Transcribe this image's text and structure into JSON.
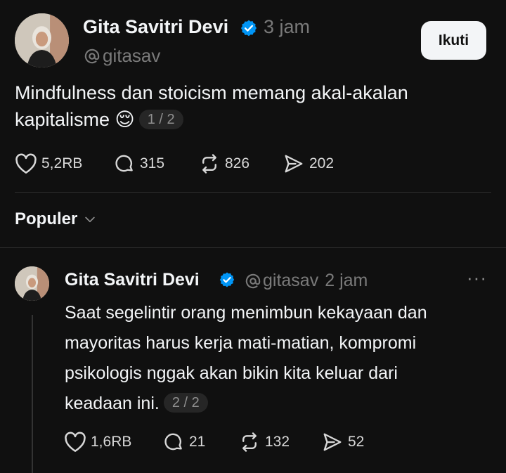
{
  "post": {
    "author": "Gita Savitri Devi",
    "handle": "gitasav",
    "time": "3 jam",
    "follow_label": "Ikuti",
    "text_line1": "Mindfulness dan stoicism memang akal-akalan",
    "text_line2": "kapitalisme 😌",
    "counter": "1 / 2",
    "likes": "5,2RB",
    "replies": "315",
    "reposts": "826",
    "shares": "202"
  },
  "sort": {
    "label": "Populer"
  },
  "reply": {
    "author": "Gita Savitri Devi",
    "handle": "gitasav",
    "time": "2 jam",
    "text_line1": "Saat segelintir orang menimbun kekayaan dan",
    "text_line2": "mayoritas harus kerja mati-matian, kompromi",
    "text_line3": "psikologis nggak akan bikin kita keluar dari",
    "text_line4": "keadaan ini.",
    "counter": "2 / 2",
    "more_label": "···",
    "likes": "1,6RB",
    "replies": "21",
    "reposts": "132",
    "shares": "52"
  },
  "colors": {
    "background": "#101010",
    "text": "#f3f5f7",
    "muted": "#7a7a7a",
    "verified": "#0095f6",
    "button_bg": "#f3f5f7"
  },
  "icons": [
    "threads-at-icon",
    "verified-badge-icon",
    "heart-icon",
    "comment-icon",
    "repost-icon",
    "share-icon",
    "chevron-down-icon",
    "more-icon"
  ]
}
